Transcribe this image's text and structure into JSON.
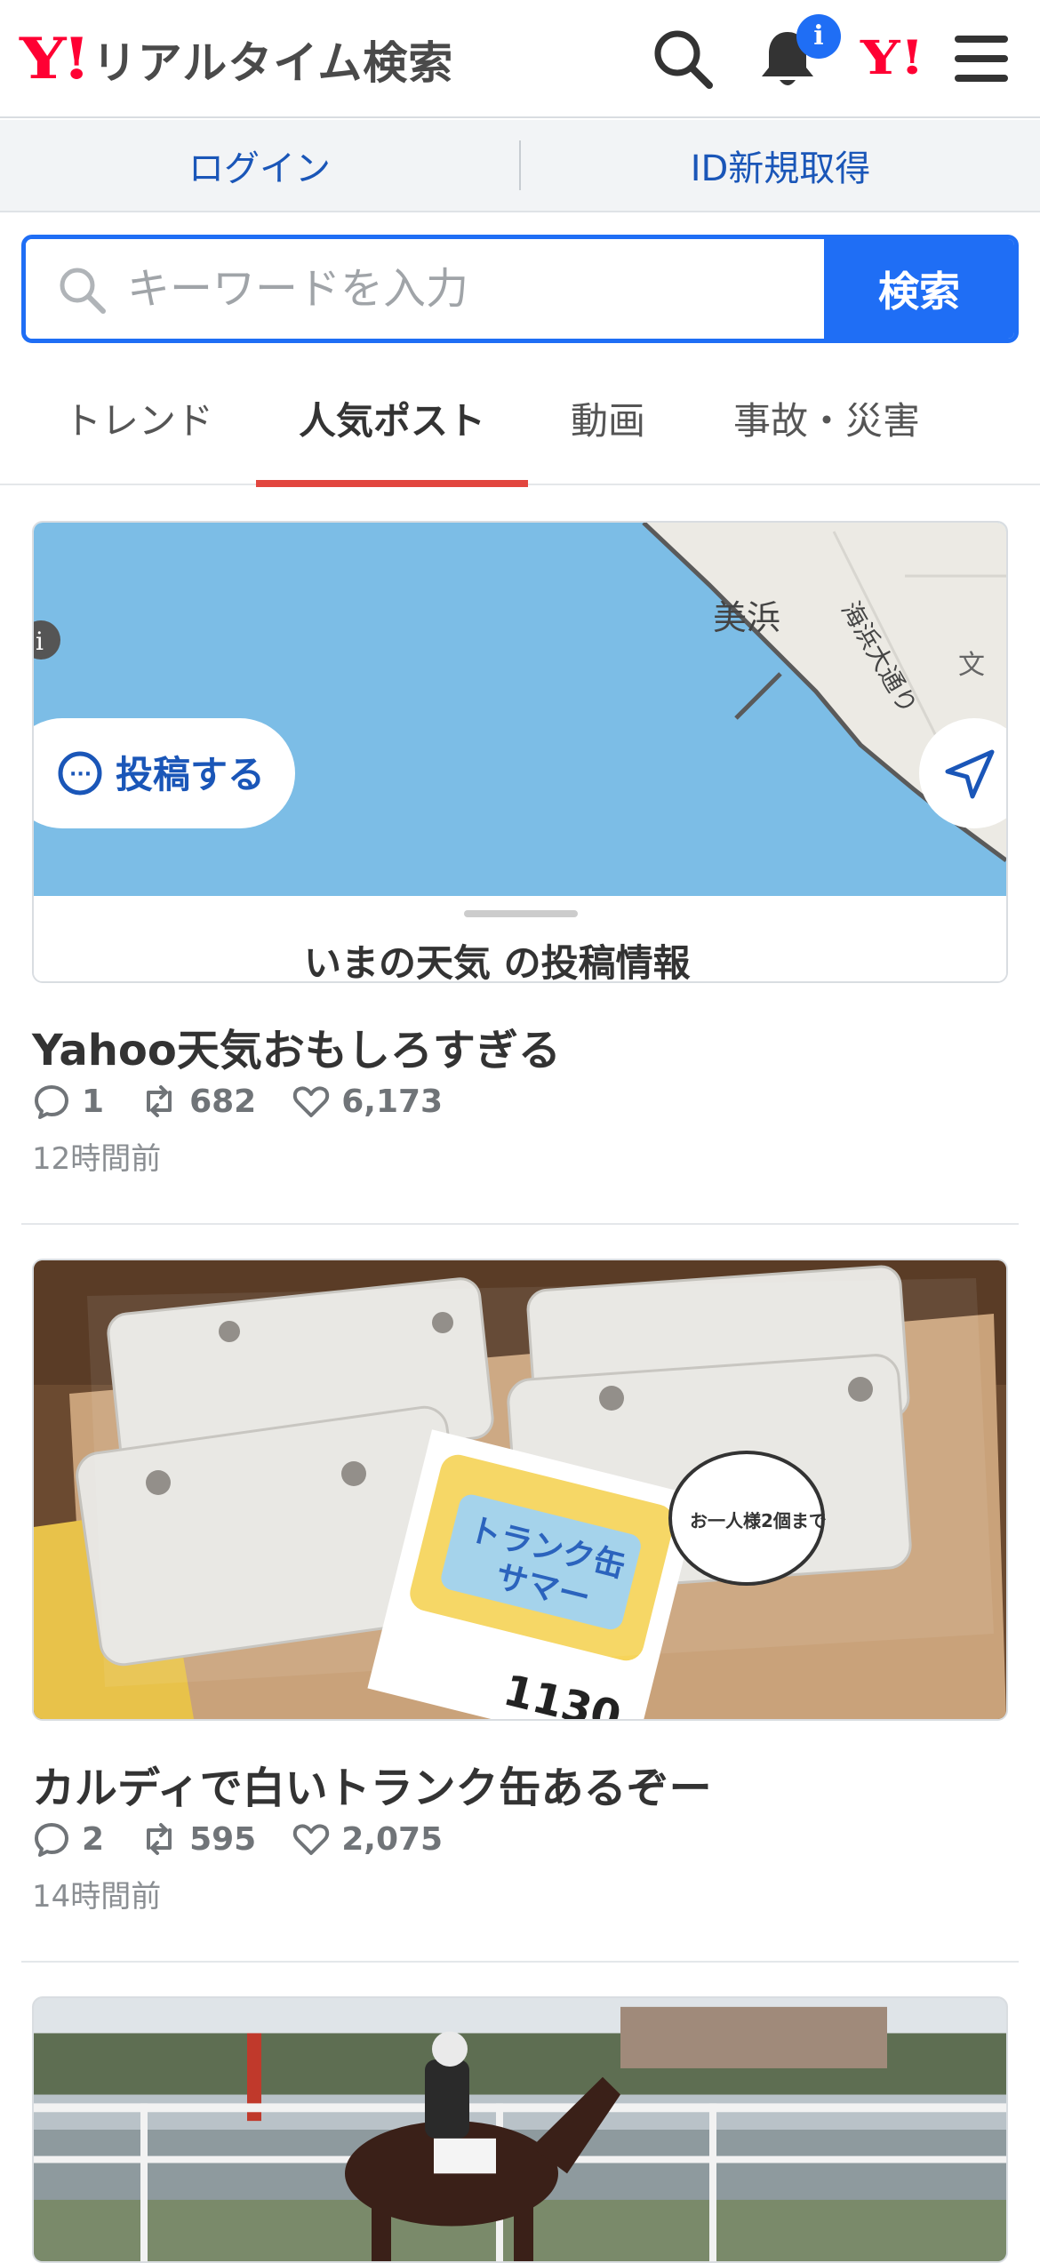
{
  "header": {
    "logo_mark": "Y!",
    "logo_text": "リアルタイム検索",
    "notification_badge": "i",
    "yahoo_jp_icon": "Y!",
    "icons": [
      "search-icon",
      "bell-icon",
      "yahoo-japan-icon",
      "menu-icon"
    ],
    "accent_color": "#ff0033"
  },
  "account_bar": {
    "login_label": "ログイン",
    "register_label": "ID新規取得"
  },
  "search": {
    "placeholder": "キーワードを入力",
    "value": "",
    "button_label": "検索",
    "color": "#1f6ef5"
  },
  "tabs": {
    "items": [
      {
        "label": "トレンド",
        "active": false
      },
      {
        "label": "人気ポスト",
        "active": true
      },
      {
        "label": "動画",
        "active": false
      },
      {
        "label": "事故・災害",
        "active": false
      }
    ],
    "active_color": "#e2463f"
  },
  "posts": [
    {
      "image_text": {
        "place_label": "美浜",
        "street_label": "海浜大通り",
        "school_symbol": "文",
        "post_button": "投稿する",
        "panel_title": "いまの天気 の投稿情報"
      },
      "title": "Yahoo天気おもしろすぎる",
      "replies": "1",
      "reposts": "682",
      "likes": "6,173",
      "time": "12時間前"
    },
    {
      "image_text": {
        "sign_line1": "トランク缶",
        "sign_line2": "サマー",
        "sign_price": "1130",
        "sign_limit": "お一人様2個まで"
      },
      "title": "カルディで白いトランク缶あるぞー",
      "replies": "2",
      "reposts": "595",
      "likes": "2,075",
      "time": "14時間前"
    },
    {
      "image_text": {},
      "title": "",
      "replies": "",
      "reposts": "",
      "likes": "",
      "time": ""
    }
  ]
}
